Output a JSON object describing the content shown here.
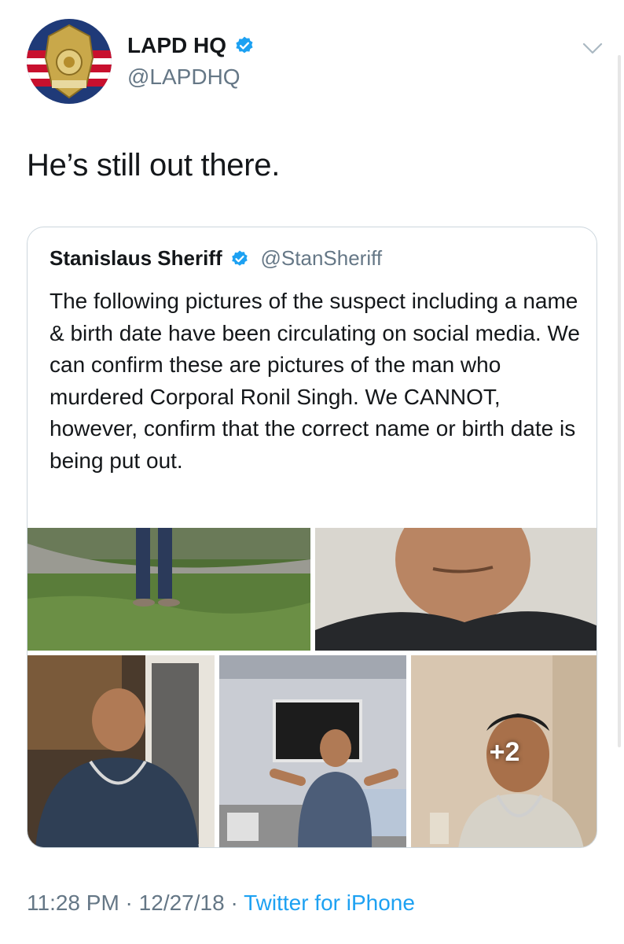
{
  "account": {
    "display_name": "LAPD HQ",
    "handle": "@LAPDHQ",
    "avatar_icon": "lapd-badge-icon",
    "verified_icon": "verified-badge-icon"
  },
  "tweet": {
    "text": "He’s still out there."
  },
  "quoted_tweet": {
    "display_name": "Stanislaus Sheriff",
    "handle": "@StanSheriff",
    "text": "The following pictures of the suspect including a name & birth date have been circulating on social media.  We can confirm these are pictures of the man who murdered Corporal Ronil Singh.  We CANNOT, however, confirm that the correct name or birth date is being put out.",
    "more_photos_label": "+2"
  },
  "footer": {
    "time": "11:28 PM",
    "separator": " · ",
    "date": "12/27/18",
    "source": "Twitter for iPhone"
  },
  "colors": {
    "link_blue": "#1da1f2",
    "secondary_text": "#657786",
    "primary_text": "#14171a",
    "border": "#ccd6dd"
  }
}
